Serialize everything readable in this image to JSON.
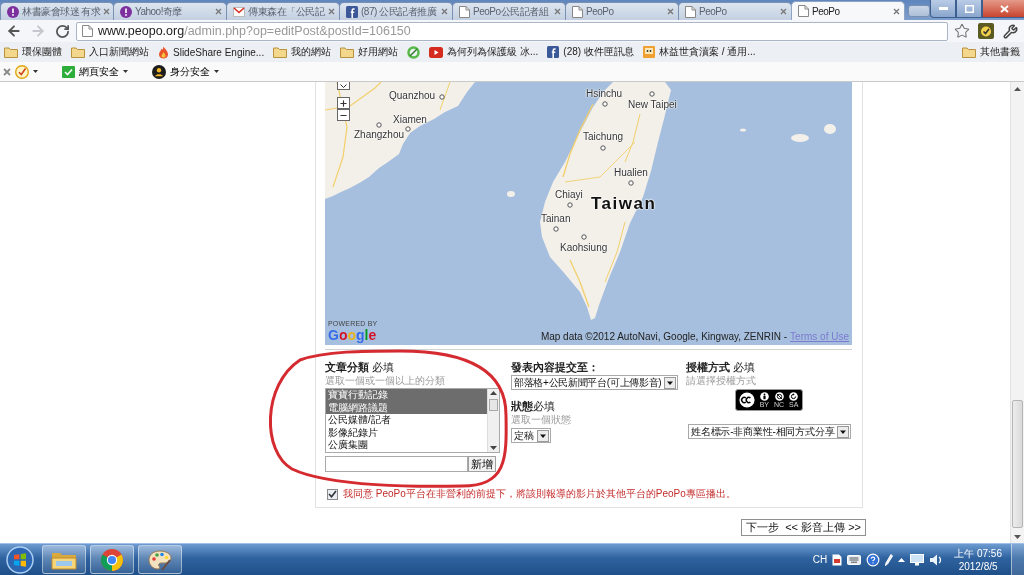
{
  "tabs": [
    {
      "title": "林書豪會球迷 有求",
      "kind": "badge",
      "selected": false
    },
    {
      "title": "Yahoo!奇摩",
      "kind": "badge",
      "selected": false
    },
    {
      "title": "傳東森在「公民記",
      "kind": "mail",
      "selected": false
    },
    {
      "title": "(87) 公民記者推廣",
      "kind": "square",
      "selected": false
    },
    {
      "title": "PeoPo公民記者組",
      "kind": "page",
      "selected": false
    },
    {
      "title": "PeoPo",
      "kind": "page",
      "selected": false
    },
    {
      "title": "PeoPo",
      "kind": "page",
      "selected": false
    },
    {
      "title": "PeoPo",
      "kind": "page",
      "selected": true
    }
  ],
  "address": {
    "host": "www.peopo.org",
    "path": "/admin.php?op=editPost&postId=106150"
  },
  "bookmarks": [
    {
      "label": "環保團體",
      "kind": "folder"
    },
    {
      "label": "入口新聞網站",
      "kind": "folder"
    },
    {
      "label": "SlideShare Engine...",
      "kind": "flame"
    },
    {
      "label": "我的網站",
      "kind": "folder"
    },
    {
      "label": "好用網站",
      "kind": "folder"
    },
    {
      "kind": "swirl"
    },
    {
      "label": "為何列為保護級 冰...",
      "kind": "video"
    },
    {
      "label": "(28) 收件匣訊息",
      "kind": "square"
    },
    {
      "label": "林益世貪瀆案 / 通用...",
      "kind": "tile"
    }
  ],
  "other_bookmarks": {
    "label": "其他書籤",
    "kind": "folder"
  },
  "addons": [
    {
      "kind": "check"
    },
    {
      "kind": "ok",
      "label": "網頁安全"
    },
    {
      "kind": "identity",
      "label": "身分安全"
    }
  ],
  "map": {
    "places": [
      {
        "name": "Quanzhou",
        "kind": "city"
      },
      {
        "name": "Xiamen",
        "kind": "city"
      },
      {
        "name": "Zhangzhou",
        "kind": "city"
      },
      {
        "name": "Hsinchu",
        "kind": "city"
      },
      {
        "name": "New Taipei",
        "kind": "city"
      },
      {
        "name": "Taichung",
        "kind": "city"
      },
      {
        "name": "Hualien",
        "kind": "city"
      },
      {
        "name": "Chiayi",
        "kind": "city"
      },
      {
        "name": "Taiwan",
        "kind": "region"
      },
      {
        "name": "Tainan",
        "kind": "city"
      },
      {
        "name": "Kaohsiung",
        "kind": "city"
      }
    ],
    "powered_by": "POWERED BY",
    "logo": "Google",
    "attribution": "Map data ©2012 AutoNavi, Google, Kingway, ZENRIN -",
    "terms_link": "Terms of Use"
  },
  "form": {
    "category": {
      "title": "**文章分類** 必填",
      "hint": "選取一個或一個以上的分類",
      "options": [
        {
          "label": "寶寶行動記錄",
          "selected": true
        },
        {
          "label": "電腦網路議題",
          "selected": true
        },
        {
          "label": "公民媒體/記者",
          "selected": false
        },
        {
          "label": "影像紀錄片",
          "selected": false
        },
        {
          "label": "公廣集團",
          "selected": false
        }
      ],
      "add_button": "新增"
    },
    "target": {
      "title": "發表內容提交至：",
      "value": "部落格+公民新聞平台(可上傳影音)"
    },
    "status": {
      "title": "**狀態**必填",
      "hint": "選取一個狀態",
      "value": "定稿"
    },
    "license": {
      "title": "**授權方式** 必填",
      "hint": "請選擇授權方式",
      "badge": [
        "BY",
        "NC",
        "SA"
      ],
      "value": "姓名標示-非商業性-相同方式分享"
    },
    "agreement": {
      "checked": true,
      "text": "我同意 PeoPo平台在非營利的前提下，將該則報導的影片於其他平台的PeoPo專區播出。"
    }
  },
  "next_button": "下一步  << 影音上傳 >>",
  "taskbar": {
    "apps": [
      {
        "kind": "folder"
      },
      {
        "kind": "browser"
      },
      {
        "kind": "palette"
      }
    ],
    "language": "CH",
    "clock": {
      "time": "上午 07:56",
      "date": "2012/8/5"
    }
  }
}
